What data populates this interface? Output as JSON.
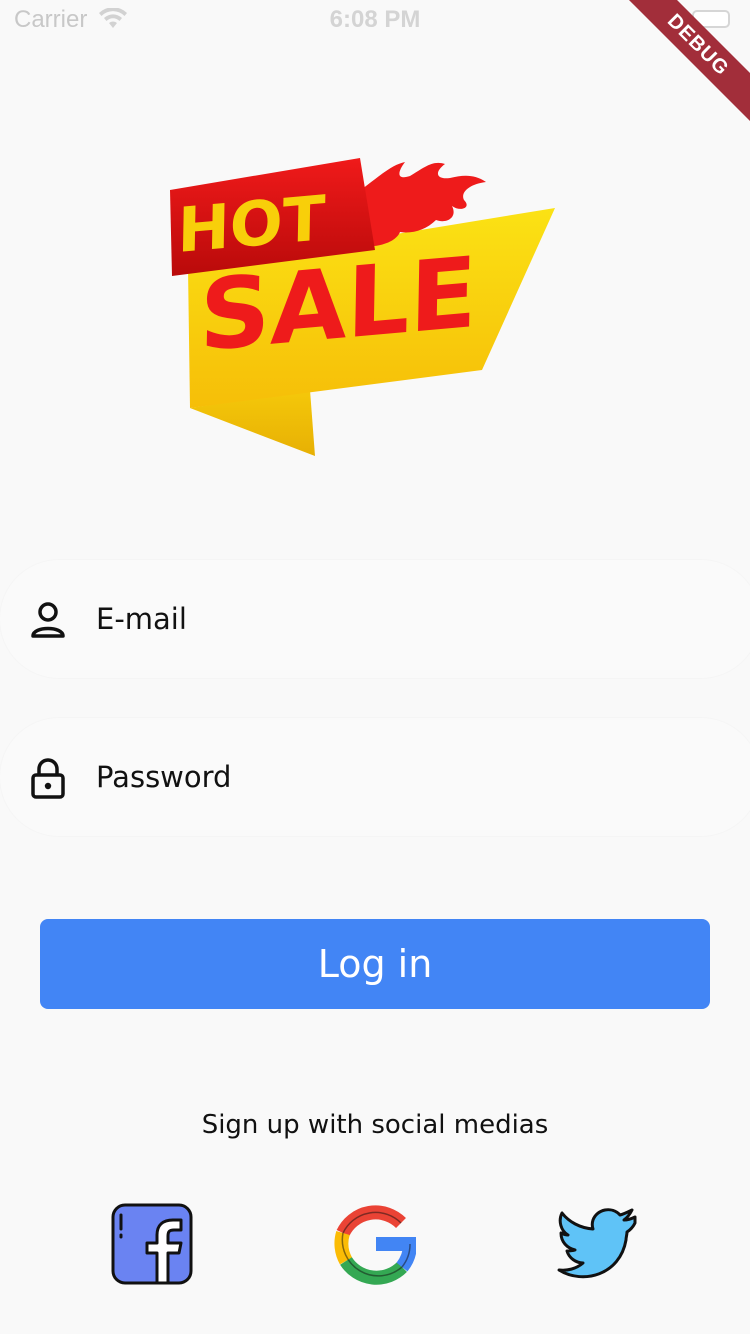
{
  "status_bar": {
    "carrier": "Carrier",
    "time": "6:08 PM"
  },
  "debug_banner": {
    "label": "DEBUG"
  },
  "logo": {
    "line1": "HOT",
    "line2": "SALE"
  },
  "form": {
    "email_placeholder": "E-mail",
    "password_placeholder": "Password",
    "email_icon": "person-icon",
    "password_icon": "lock-icon"
  },
  "login_button": {
    "label": "Log in"
  },
  "social": {
    "caption": "Sign up with social medias",
    "items": [
      {
        "icon": "facebook-icon"
      },
      {
        "icon": "google-icon"
      },
      {
        "icon": "twitter-icon"
      }
    ]
  },
  "colors": {
    "primary": "#4285f5",
    "background": "#f9f9f9",
    "debug_banner": "#a22e3a",
    "logo_red": "#ee1b1b",
    "logo_yellow": "#f8cf0a"
  }
}
